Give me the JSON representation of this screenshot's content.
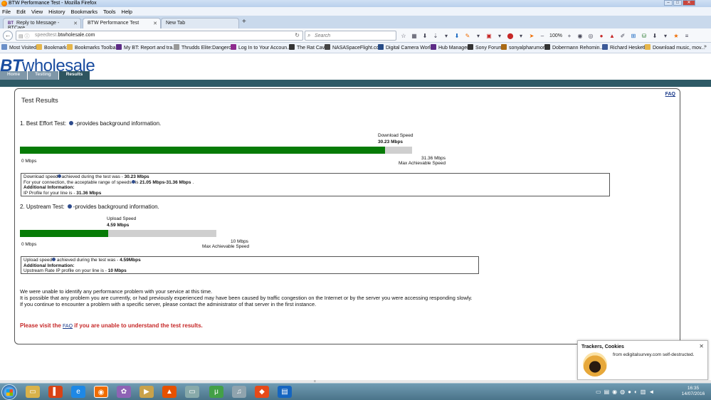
{
  "window": {
    "title": "BTW Performance Test - Mozilla Firefox"
  },
  "menu": [
    "File",
    "Edit",
    "View",
    "History",
    "Bookmarks",
    "Tools",
    "Help"
  ],
  "tabs": [
    {
      "label": "Reply to Message - BTCare...",
      "icon": "bt-favicon"
    },
    {
      "label": "BTW Performance Test",
      "icon": "none"
    },
    {
      "label": "New Tab",
      "icon": "none"
    }
  ],
  "url": {
    "prefix": "speedtest.",
    "host": "btwholesale.com"
  },
  "search": {
    "placeholder": "Search"
  },
  "toolbar": {
    "zoom": "100%"
  },
  "bookmarks": [
    "Most Visited",
    "Bookmarks",
    "Bookmarks Toolbar",
    "My BT: Report and tra...",
    "Thrudds Elite:Dangero...",
    "Log In to Your Accoun...",
    "The Rat Cave",
    "NASASpaceFlight.com",
    "Digital Camera World",
    "Hub Manager",
    "Sony Forum",
    "sonyalpharumors",
    "Dobermann Rehomin...",
    "Richard Hesketh",
    "Download music, mov..."
  ],
  "site": {
    "logo_bt": "BT",
    "logo_rest": "wholesale",
    "nav": [
      "Home",
      "Testing",
      "Results"
    ]
  },
  "results": {
    "title": "Test Results",
    "faq": "FAQ",
    "best_effort": {
      "heading_pre": "1. Best Effort Test:",
      "heading_post": "-provides background information.",
      "speed_label": "Download Speed",
      "speed_value": "30.23 Mbps",
      "measured_mbps": 30.23,
      "max_mbps": 31.36,
      "min_label": "0 Mbps",
      "max_label": "31.36 Mbps",
      "max_caption": "Max Achievable Speed",
      "line1_pre": "Download speed",
      "line1_mid": "achieved during the test was - ",
      "line1_val": "30.23 Mbps",
      "line2_pre": "For your connection, the acceptable range of speeds",
      "line2_mid": "is ",
      "line2_val": "21.05 Mbps-31.36 Mbps",
      "line2_end": " .",
      "line3": "Additional Information:",
      "line4_pre": "IP Profile for your line is - ",
      "line4_val": "31.36 Mbps"
    },
    "upstream": {
      "heading_pre": "2. Upstream Test:",
      "heading_post": "-provides background information.",
      "speed_label": "Upload Speed",
      "speed_value": "4.59 Mbps",
      "measured_mbps": 4.59,
      "max_mbps": 10,
      "min_label": "0 Mbps",
      "max_label": "10 Mbps",
      "max_caption": "Max Achievable Speed",
      "line1_pre": "Upload speed",
      "line1_mid": " achieved during the test was - ",
      "line1_val": "4.59Mbps",
      "line2": "Additional Information:",
      "line3_pre": "Upstream Rate IP profile on your line is - ",
      "line3_val": "10 Mbps"
    },
    "message": [
      "We were unable to identify any performance problem with your service at this time.",
      "It is possible that any problem you are currently, or had previously experienced may have been caused by traffic congestion on the Internet or by the server you were accessing responding slowly.",
      "If you continue to encounter a problem with a specific server, please contact the administrator of that server in the first instance."
    ],
    "visit_pre": "Please visit the ",
    "visit_link": "FAQ",
    "visit_post": " if you are unable to understand the test results."
  },
  "notification": {
    "title": "Trackers, Cookies",
    "message": "from edigitalsurvey.com self-destructed."
  },
  "clock": {
    "time": "16:35",
    "date": "14/07/2016"
  },
  "colors": {
    "bar_fill": "#067b06",
    "bar_empty": "#cfcfcf",
    "brand": "#1a4da0",
    "alert": "#c62828"
  }
}
